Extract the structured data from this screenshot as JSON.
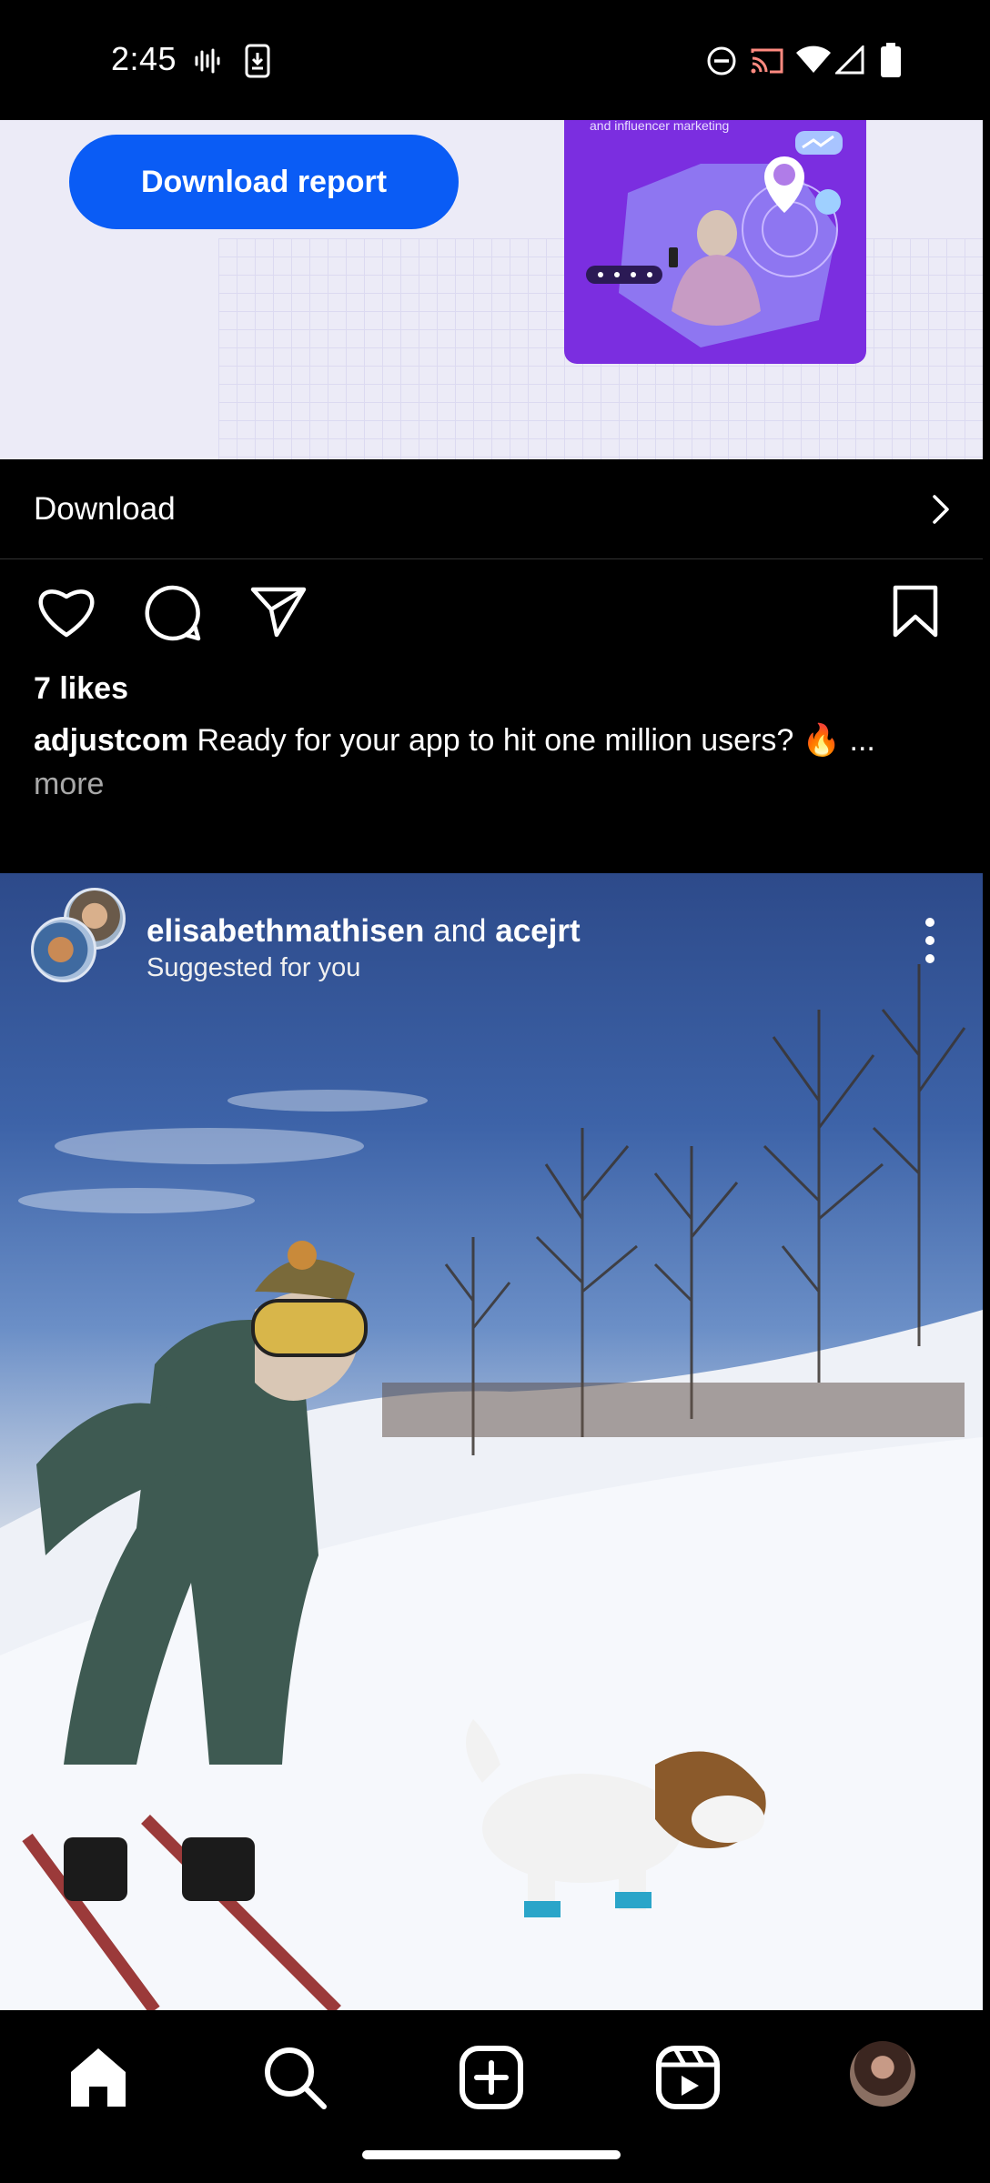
{
  "status_bar": {
    "time": "2:45",
    "icons": [
      "voice-wave-icon",
      "download-phone-icon",
      "do-not-disturb-icon",
      "cast-icon",
      "wifi-icon",
      "signal-icon",
      "battery-icon"
    ]
  },
  "ad": {
    "button_label": "Download report",
    "card_caption": "and influencer marketing",
    "brand_color": "#0a5cf5",
    "card_color": "#7b2ee0"
  },
  "cta": {
    "label": "Download"
  },
  "post1": {
    "likes": "7 likes",
    "username": "adjustcom",
    "caption": "Ready for your app to hit one million users? 🔥 ...",
    "more": "more"
  },
  "post2": {
    "user_a": "elisabethmathisen",
    "joiner": " and ",
    "user_b": "acejrt",
    "subtitle": "Suggested for you"
  },
  "nav": {
    "items": [
      "home-icon",
      "search-icon",
      "create-post-icon",
      "reels-icon",
      "profile-avatar"
    ],
    "active": "home-icon"
  }
}
